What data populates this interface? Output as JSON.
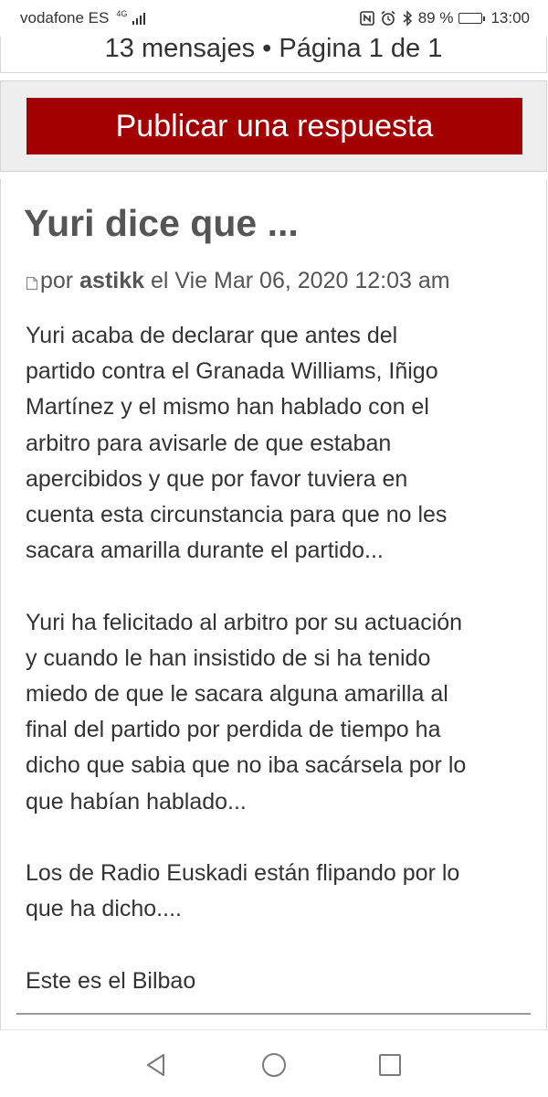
{
  "status_bar": {
    "carrier": "vodafone ES",
    "network_type": "4G",
    "battery_percent": "89 %",
    "battery_level": 0.89,
    "time": "13:00",
    "icons": [
      "nfc-icon",
      "alarm-icon",
      "bluetooth-icon",
      "battery-icon",
      "signal-icon"
    ]
  },
  "topic": {
    "pagination": "13 mensajes • Página 1 de 1",
    "reply_button_label": "Publicar una respuesta",
    "reply_button_color": "#a30002"
  },
  "post": {
    "title": "Yuri dice que ...",
    "meta_prefix": "por",
    "author": "astikk",
    "meta_suffix": "el Vie Mar 06, 2020 12:03 am",
    "paragraphs": [
      [
        "Yuri acaba de declarar que antes del",
        "partido contra el Granada Williams, Iñigo",
        "Martínez y el mismo han hablado con el",
        "arbitro para avisarle de que estaban",
        "apercibidos y que por favor tuviera en",
        "cuenta esta circunstancia para que no les",
        "sacara amarilla durante el partido..."
      ],
      [
        "Yuri ha felicitado al arbitro por su actuación",
        "y cuando le han insistido de si ha tenido",
        "miedo de que le sacara alguna amarilla al",
        "final del partido por perdida de tiempo ha",
        "dicho que sabia que no iba sacársela por lo",
        "que habían hablado..."
      ],
      [
        "Los de Radio Euskadi están flipando por lo",
        "que ha dicho...."
      ],
      [
        "Este es el Bilbao"
      ]
    ]
  },
  "nav_bar": {
    "buttons": [
      "back-icon",
      "home-icon",
      "recent-apps-icon"
    ]
  }
}
